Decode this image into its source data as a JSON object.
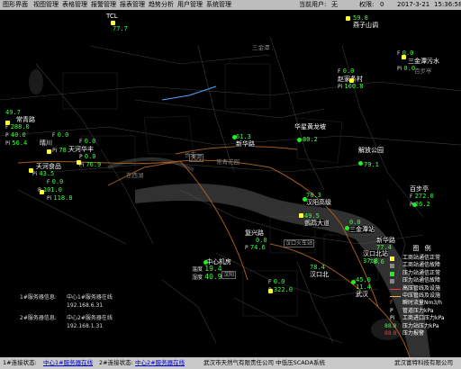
{
  "menu": {
    "items": [
      "图形界面",
      "视图管理",
      "表格管理",
      "报警管理",
      "报表管理",
      "趋势分析",
      "用户管理",
      "系统管理"
    ],
    "current_user_label": "当前用户:",
    "current_user": "无",
    "permission_label": "权限:",
    "permission_value": "0",
    "date": "2017-3-21",
    "time": "15:36:58"
  },
  "map": {
    "areas": [
      {
        "label": "三金潭"
      },
      {
        "label": "长丰"
      },
      {
        "label": "常青花园"
      },
      {
        "label": "百步亭"
      },
      {
        "label": "东西湖"
      }
    ],
    "box_labels": [
      {
        "label": "天河"
      },
      {
        "label": "汉口火车站"
      },
      {
        "label": "汉阳"
      }
    ]
  },
  "stations": [
    {
      "name": "TCL",
      "lines": [
        {
          "k": "",
          "v": "77.7"
        }
      ]
    },
    {
      "name": "燕子山调",
      "lines": [
        {
          "k": "",
          "v": "59.8"
        }
      ]
    },
    {
      "name": "三金潭污水",
      "lines": [
        {
          "k": "F",
          "v": "0.0"
        },
        {
          "k": "P",
          "v": "0.0"
        },
        {
          "k": "Pi",
          "v": "0.0"
        }
      ]
    },
    {
      "name": "常青路",
      "lines": [
        {
          "k": "",
          "v": "49.7"
        },
        {
          "k": "F",
          "v": "288.0"
        },
        {
          "k": "P",
          "v": "40.0"
        },
        {
          "k": "Pi",
          "v": "56.4"
        }
      ]
    },
    {
      "name": "晴川",
      "lines": [
        {
          "k": "F",
          "v": "0.0"
        },
        {
          "k": "P",
          "v": "0.0"
        },
        {
          "k": "Pi",
          "v": "78.2"
        }
      ]
    },
    {
      "name": "天河华丰",
      "lines": [
        {
          "k": "F",
          "v": "0.0"
        },
        {
          "k": "P",
          "v": "0.0"
        },
        {
          "k": "Pi",
          "v": "76.9"
        }
      ]
    },
    {
      "name": "赵家条村",
      "lines": [
        {
          "k": "F",
          "v": "0.0"
        },
        {
          "k": "P",
          "v": "0.0"
        },
        {
          "k": "Pi",
          "v": "160.8"
        }
      ]
    },
    {
      "name": "新华路",
      "lines": [
        {
          "k": "",
          "v": "61.3"
        }
      ]
    },
    {
      "name": "华星黄龙坡",
      "lines": [
        {
          "k": "",
          "v": "80.2"
        }
      ]
    },
    {
      "name": "解放公园",
      "lines": [
        {
          "k": "",
          "v": "79.1"
        }
      ]
    },
    {
      "name": "天河食品",
      "lines": [
        {
          "k": "Pi",
          "v": "43.5"
        },
        {
          "k": "F",
          "v": "0.0"
        },
        {
          "k": "P",
          "v": "101.0"
        },
        {
          "k": "Pi",
          "v": "118.8"
        }
      ]
    },
    {
      "name": "汉阳高级",
      "lines": [
        {
          "k": "",
          "v": "78.3"
        }
      ]
    },
    {
      "name": "百步亭",
      "lines": [
        {
          "k": "F",
          "v": "272.0"
        },
        {
          "k": "P",
          "v": "26.2"
        },
        {
          "k": "",
          "v": "0.0"
        }
      ]
    },
    {
      "name": "鹦鹉大道",
      "lines": [
        {
          "k": "",
          "v": "49.5"
        },
        {
          "k": "",
          "v": "90.2"
        }
      ]
    },
    {
      "name": "三金潭站",
      "lines": [
        {
          "k": "",
          "v": "0.0"
        }
      ]
    },
    {
      "name": "新华路",
      "lines": [
        {
          "k": "",
          "v": "77.4"
        }
      ]
    },
    {
      "name": "中心机房",
      "lines": [
        {
          "k": "温度",
          "v": "19.4"
        },
        {
          "k": "湿度",
          "v": "40.9"
        }
      ]
    },
    {
      "name": "复兴路",
      "lines": [
        {
          "k": "",
          "v": "0.0"
        },
        {
          "k": "P",
          "v": "74.6"
        },
        {
          "k": "",
          "v": "78.6"
        }
      ]
    },
    {
      "name": "汉口北",
      "lines": [
        {
          "k": "",
          "v": "78.4"
        },
        {
          "k": "F",
          "v": "0.0"
        },
        {
          "k": "P",
          "v": "322.0"
        },
        {
          "k": "",
          "v": "41.0"
        }
      ]
    },
    {
      "name": "武汉",
      "lines": [
        {
          "k": "",
          "v": "45.0"
        },
        {
          "k": "",
          "v": "0.0"
        },
        {
          "k": "",
          "v": "11.4"
        }
      ]
    },
    {
      "name": "武昌",
      "lines": [
        {
          "k": "",
          "v": "78.6"
        }
      ]
    },
    {
      "name": "汉口北站",
      "lines": [
        {
          "k": "",
          "v": "0.0"
        },
        {
          "k": "",
          "v": "37.8"
        }
      ]
    }
  ],
  "server_info": {
    "rows": [
      {
        "label": "1#服务器信息:",
        "name": "中心1#服务器在线",
        "ip": "192.168.6.31"
      },
      {
        "label": "2#服务器信息:",
        "name": "中心2#服务器在线",
        "ip": "192.168.1.31"
      }
    ]
  },
  "legend": {
    "title": "图 例",
    "items": [
      {
        "label": "工商站通信正常",
        "color": "#ffff33",
        "shape": "square"
      },
      {
        "label": "工商站通信故障",
        "color": "#888888",
        "shape": "square"
      },
      {
        "label": "压力站通信正常",
        "color": "#22ee22",
        "shape": "square"
      },
      {
        "label": "压力站通信故障",
        "color": "#888888",
        "shape": "square"
      },
      {
        "label": "高压管线及设施",
        "color": "#ff3333",
        "shape": "line"
      },
      {
        "label": "中压管线及设施",
        "color": "#ffb23a",
        "shape": "line"
      },
      {
        "label": "瞬时流量Nm3/h",
        "color": "#ffffff",
        "shape": "F"
      },
      {
        "label": "管道压力kPa",
        "color": "#ffffff",
        "shape": "P"
      },
      {
        "label": "工商进口压力kPa",
        "color": "#ffffff",
        "shape": "Pi"
      },
      {
        "label": "压力站压力kPa",
        "color": "#39ff39",
        "shape": "88.8"
      },
      {
        "label": "压力报警",
        "color": "#ff3333",
        "shape": "88.8"
      }
    ]
  },
  "statusbar": {
    "s1_label": "1#连接状态:",
    "s1_link": "中心1#服务器在线",
    "s2_label": "2#连接状态:",
    "s2_link": "中心2#服务器在线",
    "company": "武汉市天然气有限责任公司 中低压SCADA系统",
    "vendor": "武汉富特科技有限公司"
  },
  "colors": {
    "value": "#39ff39",
    "alarm": "#ff3333",
    "road": "#ffb23a",
    "statusbar": "#c9c9c9"
  }
}
